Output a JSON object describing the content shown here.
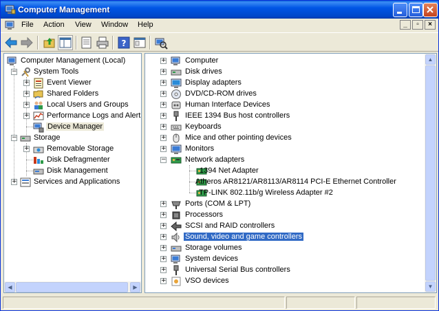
{
  "window": {
    "title": "Computer Management"
  },
  "menubar": {
    "items": [
      "File",
      "Action",
      "View",
      "Window",
      "Help"
    ]
  },
  "toolbar": {
    "buttons": [
      "back-icon",
      "forward-icon",
      "up-icon",
      "show-hide-tree-icon",
      "properties-icon",
      "print-icon",
      "help-icon",
      "view-icon",
      "scan-hardware-icon"
    ]
  },
  "tree": {
    "root": "Computer Management (Local)",
    "system_tools": "System Tools",
    "event_viewer": "Event Viewer",
    "shared_folders": "Shared Folders",
    "local_users": "Local Users and Groups",
    "perf_logs": "Performance Logs and Alerts",
    "device_manager": "Device Manager",
    "storage": "Storage",
    "removable_storage": "Removable Storage",
    "disk_defrag": "Disk Defragmenter",
    "disk_mgmt": "Disk Management",
    "services": "Services and Applications"
  },
  "devices": {
    "computer": "Computer",
    "disk_drives": "Disk drives",
    "display": "Display adapters",
    "dvd": "DVD/CD-ROM drives",
    "hid": "Human Interface Devices",
    "ieee": "IEEE 1394 Bus host controllers",
    "keyboards": "Keyboards",
    "mice": "Mice and other pointing devices",
    "monitors": "Monitors",
    "network": "Network adapters",
    "net_1394": "1394 Net Adapter",
    "net_atheros": "Atheros AR8121/AR8113/AR8114 PCI-E Ethernet Controller",
    "net_tplink": "TP-LINK 802.11b/g Wireless Adapter #2",
    "ports": "Ports (COM & LPT)",
    "processors": "Processors",
    "scsi": "SCSI and RAID controllers",
    "sound": "Sound, video and game controllers",
    "storage_vol": "Storage volumes",
    "system": "System devices",
    "usb": "Universal Serial Bus controllers",
    "vso": "VSO devices"
  },
  "colors": {
    "selection": "#316ac5",
    "titlebar": "#0055e5"
  }
}
